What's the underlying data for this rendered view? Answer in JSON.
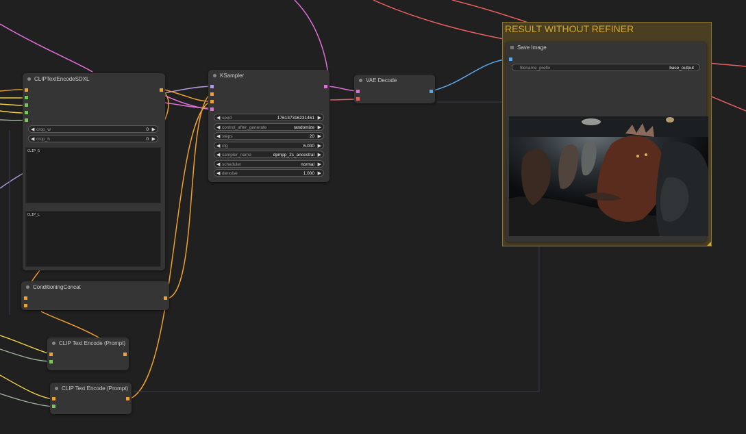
{
  "group": {
    "title": "RESULT WITHOUT REFINER"
  },
  "clip_sdxl": {
    "title": "CLIPTextEncodeSDXL",
    "widgets": [
      {
        "label": "crop_w",
        "value": "0"
      },
      {
        "label": "crop_h",
        "value": "0"
      }
    ],
    "text_clip_g_label": "CLIP_G",
    "text_clip_l_label": "CLIP_L"
  },
  "ksampler": {
    "title": "KSampler",
    "widgets": [
      {
        "label": "seed",
        "value": "176137316231461"
      },
      {
        "label": "control_after_generate",
        "value": "randomize"
      },
      {
        "label": "steps",
        "value": "20"
      },
      {
        "label": "cfg",
        "value": "6.000"
      },
      {
        "label": "sampler_name",
        "value": "dpmpp_2s_ancestral"
      },
      {
        "label": "scheduler",
        "value": "normal"
      },
      {
        "label": "denoise",
        "value": "1.000"
      }
    ]
  },
  "vae_decode": {
    "title": "VAE Decode"
  },
  "save_image": {
    "title": "Save Image",
    "filename_label": "filename_prefix",
    "filename_value": "base_output"
  },
  "conditioning_concat": {
    "title": "ConditioningConcat"
  },
  "clip_text_1": {
    "title": "CLIP Text Encode (Prompt)"
  },
  "clip_text_2": {
    "title": "CLIP Text Encode (Prompt)"
  },
  "colors": {
    "background": "#202020",
    "node_bg": "#353535",
    "group_bg": "#4a3f22",
    "group_title": "#d0a832",
    "wire_conditioning": "#f0a030",
    "wire_clip": "#f2d44c",
    "wire_model": "#b39ae0",
    "wire_latent": "#e070d8",
    "wire_vae": "#e86060",
    "wire_image": "#5aa8ea"
  },
  "icons": [
    "left-arrow-icon",
    "right-arrow-icon",
    "node-status-dot-icon"
  ]
}
